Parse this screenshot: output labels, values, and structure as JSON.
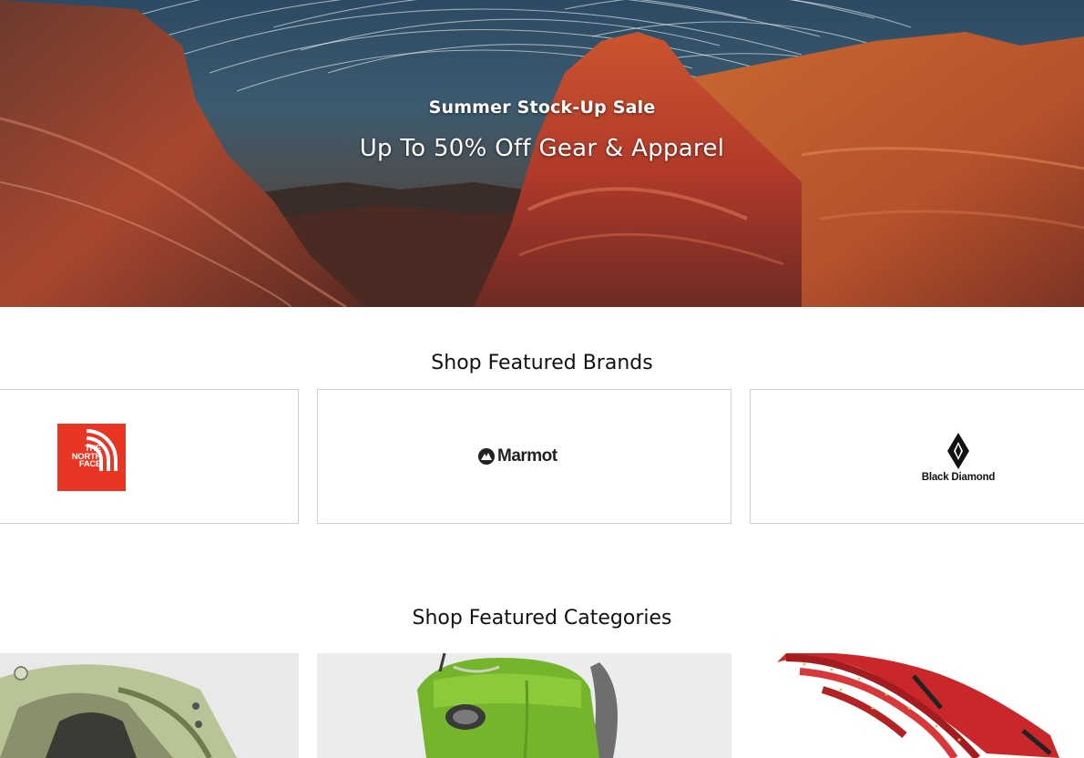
{
  "hero": {
    "kicker": "Summer Stock-Up Sale",
    "title": "Up To 50% Off Gear & Apparel"
  },
  "brands": {
    "title": "Shop Featured Brands",
    "items": [
      {
        "name": "The North Face",
        "logo_lines": [
          "THE",
          "NORTH",
          "FACE"
        ],
        "color": "#e83524"
      },
      {
        "name": "Marmot",
        "logo_text": "Marmot"
      },
      {
        "name": "Black Diamond",
        "logo_text": "Black Diamond"
      }
    ]
  },
  "categories": {
    "title": "Shop Featured Categories",
    "items": [
      {
        "image": "tent-image"
      },
      {
        "image": "backpack-image"
      },
      {
        "image": "climbing-rope-image"
      }
    ]
  }
}
